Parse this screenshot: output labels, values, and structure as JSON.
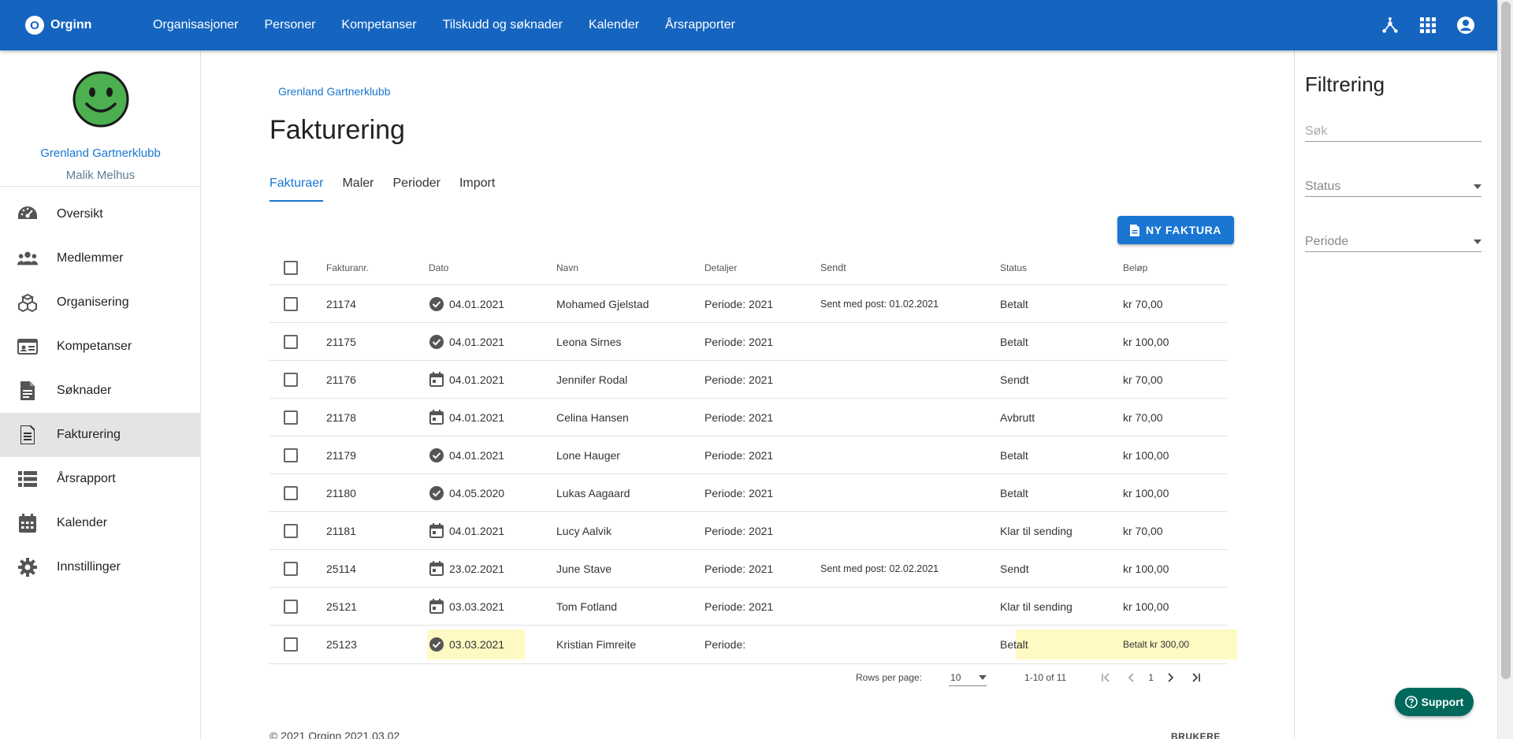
{
  "topbar": {
    "logo_letter": "O",
    "logo_text": "Orginn",
    "nav": [
      "Organisasjoner",
      "Personer",
      "Kompetanser",
      "Tilskudd og søknader",
      "Kalender",
      "Årsrapporter"
    ],
    "icons": [
      "hub-icon",
      "apps-grid-icon",
      "account-circle-icon"
    ]
  },
  "sidebar": {
    "org_name": "Grenland Gartnerklubb",
    "user_name": "Malik Melhus",
    "items": [
      {
        "label": "Oversikt",
        "icon": "speedometer-icon"
      },
      {
        "label": "Medlemmer",
        "icon": "people-icon"
      },
      {
        "label": "Organisering",
        "icon": "blocks-icon"
      },
      {
        "label": "Kompetanser",
        "icon": "id-card-icon"
      },
      {
        "label": "Søknader",
        "icon": "document-icon"
      },
      {
        "label": "Fakturering",
        "icon": "invoice-icon",
        "active": true
      },
      {
        "label": "Årsrapport",
        "icon": "list-icon"
      },
      {
        "label": "Kalender",
        "icon": "calendar-icon"
      },
      {
        "label": "Innstillinger",
        "icon": "gear-icon"
      }
    ]
  },
  "main": {
    "breadcrumb": "Grenland Gartnerklubb",
    "title": "Fakturering",
    "tabs": [
      {
        "label": "Fakturaer",
        "active": true
      },
      {
        "label": "Maler"
      },
      {
        "label": "Perioder"
      },
      {
        "label": "Import"
      }
    ],
    "new_button": "NY FAKTURA",
    "table": {
      "headers": {
        "number": "Fakturanr.",
        "date": "Dato",
        "name": "Navn",
        "details": "Detaljer",
        "sent": "Sendt",
        "status": "Status",
        "amount": "Beløp"
      },
      "rows": [
        {
          "number": "21174",
          "date_icon": "check-circle-icon",
          "date": "04.01.2021",
          "name": "Mohamed Gjelstad",
          "details": "Periode: 2021",
          "sent": "Sent med post: 01.02.2021",
          "status": "Betalt",
          "amount": "kr 70,00"
        },
        {
          "number": "21175",
          "date_icon": "check-circle-icon",
          "date": "04.01.2021",
          "name": "Leona Sirnes",
          "details": "Periode: 2021",
          "sent": "",
          "status": "Betalt",
          "amount": "kr 100,00"
        },
        {
          "number": "21176",
          "date_icon": "calendar-icon",
          "date": "04.01.2021",
          "name": "Jennifer Rodal",
          "details": "Periode: 2021",
          "sent": "",
          "status": "Sendt",
          "amount": "kr 70,00"
        },
        {
          "number": "21178",
          "date_icon": "calendar-icon",
          "date": "04.01.2021",
          "name": "Celina Hansen",
          "details": "Periode: 2021",
          "sent": "",
          "status": "Avbrutt",
          "amount": "kr 70,00"
        },
        {
          "number": "21179",
          "date_icon": "check-circle-icon",
          "date": "04.01.2021",
          "name": "Lone Hauger",
          "details": "Periode: 2021",
          "sent": "",
          "status": "Betalt",
          "amount": "kr 100,00"
        },
        {
          "number": "21180",
          "date_icon": "check-circle-icon",
          "date": "04.05.2020",
          "name": "Lukas Aagaard",
          "details": "Periode: 2021",
          "sent": "",
          "status": "Betalt",
          "amount": "kr 100,00"
        },
        {
          "number": "21181",
          "date_icon": "calendar-icon",
          "date": "04.01.2021",
          "name": "Lucy Aalvik",
          "details": "Periode: 2021",
          "sent": "",
          "status": "Klar til sending",
          "amount": "kr 70,00"
        },
        {
          "number": "25114",
          "date_icon": "calendar-icon",
          "date": "23.02.2021",
          "name": "June Stave",
          "details": "Periode: 2021",
          "sent": "Sent med post: 02.02.2021",
          "status": "Sendt",
          "amount": "kr 100,00"
        },
        {
          "number": "25121",
          "date_icon": "calendar-icon",
          "date": "03.03.2021",
          "name": "Tom Fotland",
          "details": "Periode: 2021",
          "sent": "",
          "status": "Klar til sending",
          "amount": "kr 100,00"
        },
        {
          "number": "25123",
          "date_icon": "check-circle-icon",
          "date": "03.03.2021",
          "name": "Kristian Fimreite",
          "details": "Periode:",
          "sent": "",
          "status": "Betalt",
          "amount": "Betalt kr 300,00",
          "highlighted": true
        }
      ]
    },
    "pagination": {
      "rows_per_page_label": "Rows per page:",
      "rows_per_page": "10",
      "range": "1-10 of 11",
      "page": "1"
    },
    "footer": {
      "copyright": "© 2021 Orginn 2021.03.02",
      "link": "BRUKERE"
    }
  },
  "filter": {
    "title": "Filtrering",
    "search_placeholder": "Søk",
    "status_label": "Status",
    "period_label": "Periode"
  },
  "support": {
    "label": "Support"
  },
  "colors": {
    "primary": "#1565c0",
    "accent": "#1976d2",
    "highlight": "#fff9c4",
    "support": "#00695c"
  }
}
